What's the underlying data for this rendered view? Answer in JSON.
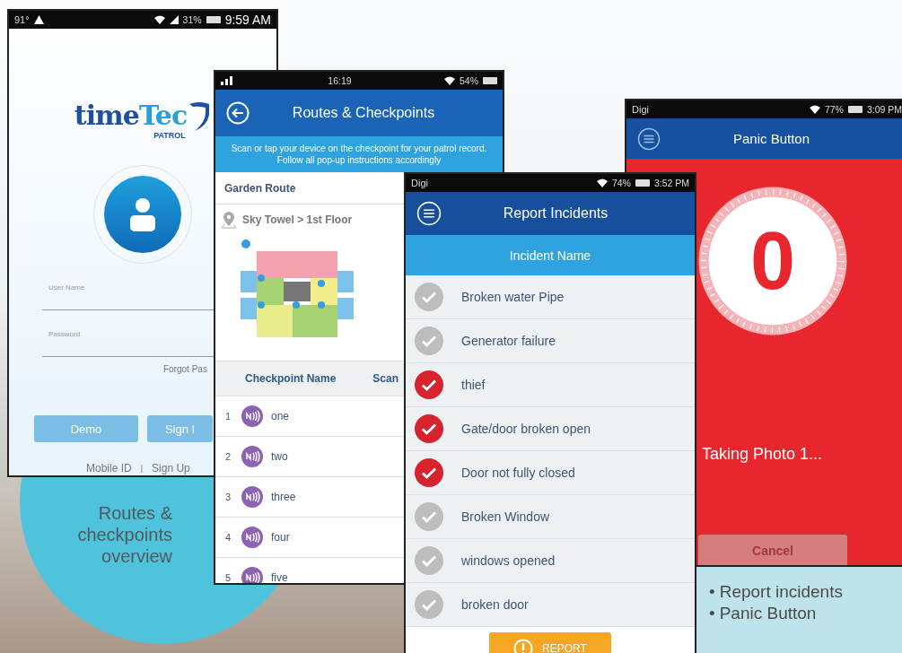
{
  "login_screen": {
    "status_bar": {
      "temperature": "91°",
      "battery": "31%",
      "time": "9:59 AM"
    },
    "logo": {
      "first": "time",
      "second": "Tec",
      "sub": "PATROL"
    },
    "fields": [
      {
        "placeholder": "User Name"
      },
      {
        "placeholder": "Password"
      }
    ],
    "forgot_link": "Forgot Pas",
    "buttons": [
      "Demo",
      "Sign I"
    ],
    "links": [
      "Mobile ID",
      "Sign Up"
    ],
    "separator": "|"
  },
  "routes_screen": {
    "status_bar": {
      "time": "16:19",
      "battery": "54%"
    },
    "title": "Routes & Checkpoints",
    "notice_lines": [
      "Scan or tap your device on the checkpoint for your patrol record.",
      "Follow all pop-up instructions accordingly"
    ],
    "route": "Garden Route",
    "location": "Sky Towel > 1st Floor",
    "columns": [
      "Checkpoint Name",
      "Scan"
    ],
    "checkpoints": [
      {
        "number": "1",
        "name": "one"
      },
      {
        "number": "2",
        "name": "two"
      },
      {
        "number": "3",
        "name": "three"
      },
      {
        "number": "4",
        "name": "four"
      },
      {
        "number": "5",
        "name": "five"
      }
    ]
  },
  "report_screen": {
    "status_bar": {
      "carrier": "Digi",
      "battery": "74%",
      "time": "3:52 PM"
    },
    "title": "Report Incidents",
    "column": "Incident Name",
    "incidents": [
      {
        "name": "Broken water Pipe",
        "checked": false
      },
      {
        "name": "Generator failure",
        "checked": false
      },
      {
        "name": "thief",
        "checked": true
      },
      {
        "name": "Gate/door broken open",
        "checked": true
      },
      {
        "name": "Door not fully closed",
        "checked": true
      },
      {
        "name": "Broken Window",
        "checked": false
      },
      {
        "name": "windows opened",
        "checked": false
      },
      {
        "name": "broken door",
        "checked": false
      }
    ],
    "report_button": "REPORT"
  },
  "panic_screen": {
    "status_bar": {
      "carrier": "Digi",
      "battery": "77%",
      "time": "3:09 PM"
    },
    "title": "Panic Button",
    "countdown": "0",
    "status_text": "Taking Photo 1...",
    "cancel_button": "Cancel"
  },
  "captions": {
    "left_lines": [
      "Routes &",
      "checkpoints",
      "overview"
    ],
    "bullet": "•",
    "right_items": [
      "Report incidents",
      "Panic Button"
    ]
  }
}
